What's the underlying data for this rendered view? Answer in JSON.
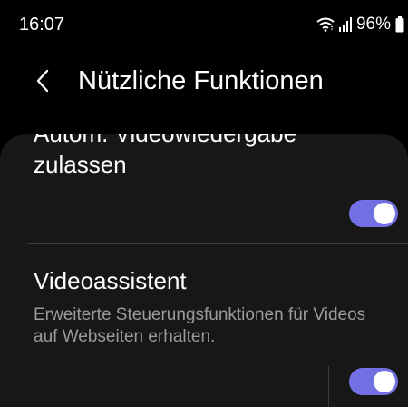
{
  "status_bar": {
    "time": "16:07",
    "battery": "96%",
    "icons": [
      "wifi-icon",
      "signal-icon",
      "battery-icon"
    ]
  },
  "header": {
    "title": "Nützliche Funktionen",
    "back_icon": "back-icon"
  },
  "settings": {
    "items": [
      {
        "title_line1": "Autom. Videowiedergabe",
        "title_line2": "zulassen",
        "toggle_on": true
      },
      {
        "title": "Videoassistent",
        "summary_line1": "Erweiterte Steuerungsfunktionen für Videos",
        "summary_line2": "auf Webseiten erhalten.",
        "toggle_on": true
      }
    ]
  },
  "colors": {
    "background": "#000000",
    "card": "#171717",
    "accent": "#7271e4",
    "summary_text": "#9b9b9b",
    "divider": "#3a3a3a"
  }
}
